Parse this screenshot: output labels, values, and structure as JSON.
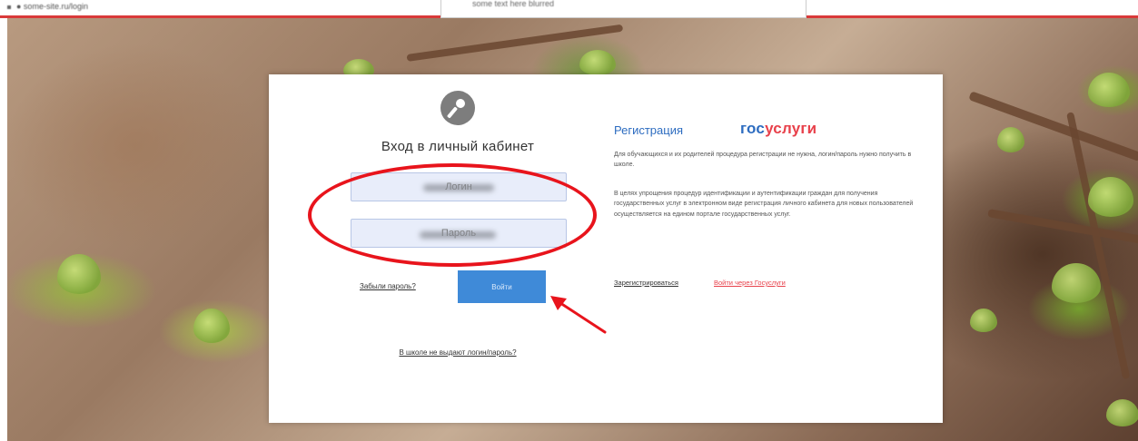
{
  "browser": {
    "top_left_text": "● some-site.ru/login",
    "top_popup_text": "some text here blurred"
  },
  "login": {
    "title": "Вход в личный кабинет",
    "login_placeholder": "Логин",
    "password_placeholder": "Пароль",
    "forgot_password": "Забыли пароль?",
    "submit_label": "Войти",
    "school_link": "В школе не выдают логин/пароль?"
  },
  "registration": {
    "title": "Регистрация",
    "logo_part1": "гос",
    "logo_part2": "услуги",
    "paragraph1": "Для обучающихся и их родителей процедура регистрации не нужна, логин/пароль нужно получить в школе.",
    "paragraph2": "В целях упрощения процедур идентификации и аутентификации граждан для получения государственных услуг в электронном виде регистрация личного кабинета для новых пользователей осуществляется на едином портале государственных услуг.",
    "register_link": "Зарегистрироваться",
    "gosuslugi_link": "Войти через Госуслуги"
  },
  "colors": {
    "accent_blue": "#3f8ad8",
    "gosuslugi_blue": "#2d6cc0",
    "gosuslugi_red": "#e8414b",
    "annotation_red": "#e8141c"
  }
}
